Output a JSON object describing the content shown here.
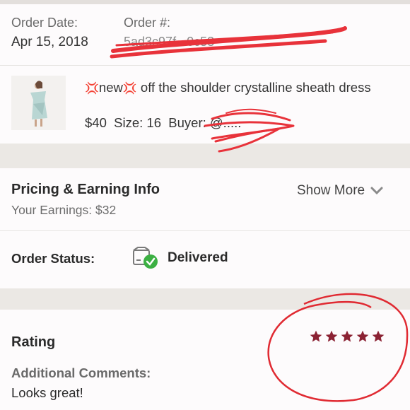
{
  "order": {
    "date_label": "Order Date:",
    "date_value": "Apr 15, 2018",
    "number_label": "Order #:",
    "number_value": "5ad3c97f...0c53"
  },
  "item": {
    "emoji_left": "💢",
    "title_word": "new",
    "emoji_right": "💢",
    "title_rest": " off the shoulder crystalline sheath dress",
    "price": "$40",
    "size": "Size: 16",
    "buyer": "Buyer: @....."
  },
  "pricing": {
    "title": "Pricing & Earning Info",
    "earnings": "Your Earnings: $32",
    "show_more": "Show More"
  },
  "status": {
    "label": "Order Status:",
    "value": "Delivered"
  },
  "rating": {
    "label": "Rating",
    "stars": 5,
    "comments_label": "Additional Comments:",
    "comments_value": "Looks great!"
  },
  "colors": {
    "annotation_red": "#e8323a",
    "star_color": "#8b2233",
    "delivered_green": "#3cb043"
  }
}
